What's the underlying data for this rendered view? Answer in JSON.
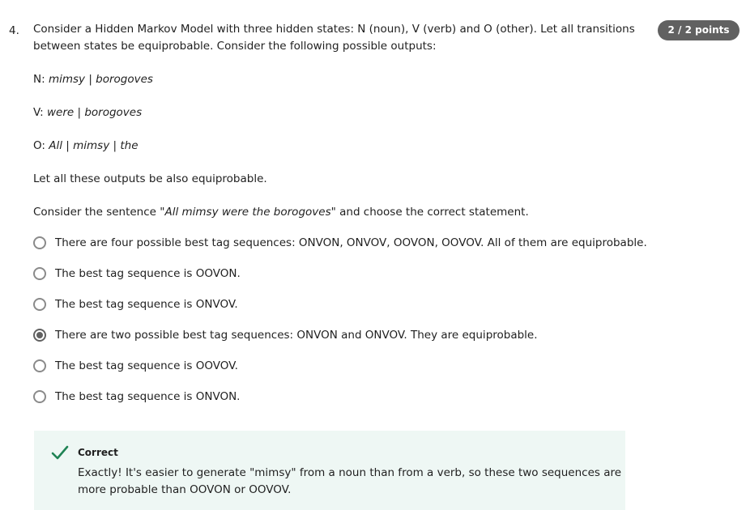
{
  "question": {
    "number": "4.",
    "points": "2 / 2 points",
    "intro": "Consider a Hidden Markov Model with three hidden states: N (noun), V (verb) and O (other). Let all transitions between states be equiprobable. Consider the following possible outputs:",
    "outputs": [
      {
        "prefix": "N: ",
        "words": [
          "mimsy",
          "borogoves"
        ]
      },
      {
        "prefix": "V: ",
        "words": [
          "were",
          "borogoves"
        ]
      },
      {
        "prefix": "O: ",
        "words": [
          "All",
          "mimsy",
          "the"
        ]
      }
    ],
    "outputs_separator": " | ",
    "equiprobable_note": "Let all these outputs be also equiprobable.",
    "sentence_prefix": "Consider the sentence \"",
    "sentence": "All mimsy were the borogoves",
    "sentence_suffix": "\" and choose the correct statement."
  },
  "options": [
    {
      "label": "There are four possible best tag sequences: ONVON, ONVOV, OOVON, OOVOV. All of them are equiprobable.",
      "selected": false
    },
    {
      "label": "The best tag sequence is OOVON.",
      "selected": false
    },
    {
      "label": "The best tag sequence is ONVOV.",
      "selected": false
    },
    {
      "label": "There are two possible best tag sequences: ONVON and ONVOV. They are equiprobable.",
      "selected": true
    },
    {
      "label": "The best tag sequence is OOVOV.",
      "selected": false
    },
    {
      "label": "The best tag sequence is ONVON.",
      "selected": false
    }
  ],
  "feedback": {
    "title": "Correct",
    "text": "Exactly! It's easier to generate \"mimsy\" from a noun than from a verb, so these two sequences are more probable than OOVON or OOVOV.",
    "icon": "checkmark-icon",
    "color": "#1f8354",
    "background": "#eef7f4"
  },
  "colors": {
    "badge": "#616161",
    "radio_selected": "#616161",
    "radio_border": "#8a8a8a"
  }
}
